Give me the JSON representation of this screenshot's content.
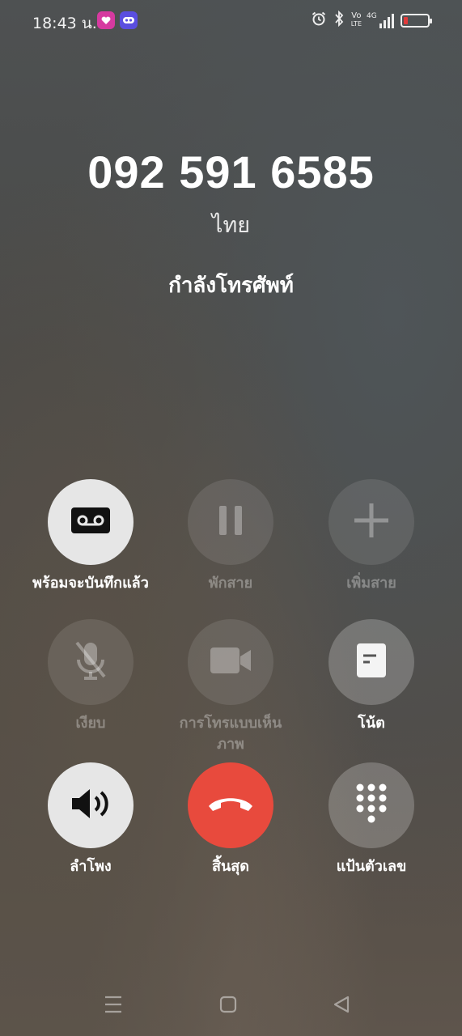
{
  "status_bar": {
    "time": "18:43 น.",
    "notification_icons": [
      "line-icon",
      "app-icon"
    ],
    "system_icons": [
      "alarm-icon",
      "bluetooth-icon",
      "volte-icon",
      "4g-signal-icon",
      "battery-low-icon"
    ],
    "volte_label_top": "Vo",
    "volte_label_bottom": "LTE",
    "network_label": "4G"
  },
  "call": {
    "number": "092 591 6585",
    "country": "ไทย",
    "status": "กำลังโทรศัพท์"
  },
  "controls": [
    {
      "label": "พร้อมจะบันทึกแล้ว",
      "icon": "record-icon",
      "enabled": true
    },
    {
      "label": "พักสาย",
      "icon": "pause-icon",
      "enabled": false
    },
    {
      "label": "เพิ่มสาย",
      "icon": "add-call-icon",
      "enabled": false
    },
    {
      "label": "เงียบ",
      "icon": "mute-icon",
      "enabled": false
    },
    {
      "label": "การโทรแบบเห็นภาพ",
      "icon": "video-call-icon",
      "enabled": false
    },
    {
      "label": "โน้ต",
      "icon": "note-icon",
      "enabled": true
    },
    {
      "label": "ลำโพง",
      "icon": "speaker-icon",
      "enabled": true
    },
    {
      "label": "สิ้นสุด",
      "icon": "end-call-icon",
      "enabled": true
    },
    {
      "label": "แป้นตัวเลข",
      "icon": "dialpad-icon",
      "enabled": true
    }
  ],
  "colors": {
    "end_call": "#e84a3d",
    "battery_low": "#e23b3b",
    "active_button": "#e6e6e6"
  },
  "nav_bar": [
    "menu-icon",
    "home-icon",
    "back-icon"
  ]
}
